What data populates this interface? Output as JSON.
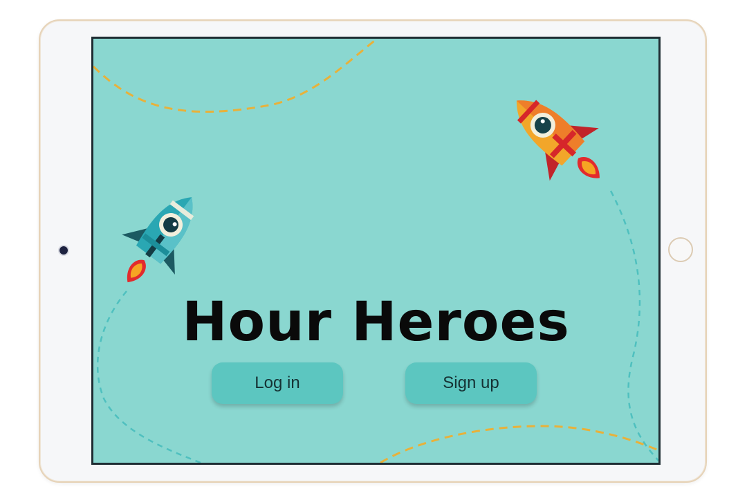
{
  "app": {
    "title": "Hour Heroes"
  },
  "actions": {
    "login_label": "Log in",
    "signup_label": "Sign up"
  },
  "colors": {
    "screen_background": "#8ad7d0",
    "button": "#5cc6c0",
    "dash_orange": "#e8b13a",
    "dash_teal": "#4fc0bf",
    "rocket_teal": "#2aa7b3",
    "rocket_orange": "#f2a62a",
    "rocket_red": "#d6262a"
  },
  "icons": [
    "rocket-icon",
    "rocket-icon"
  ]
}
